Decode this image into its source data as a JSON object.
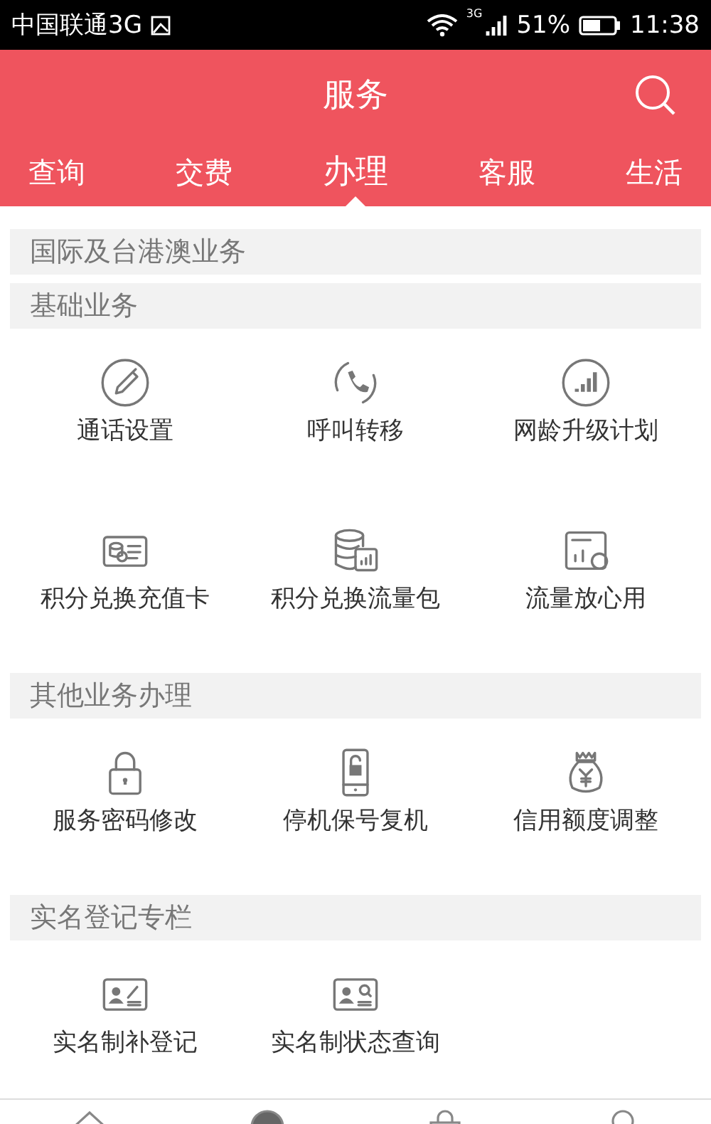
{
  "status_bar": {
    "carrier": "中国联通3G",
    "network": "3G",
    "battery": "51%",
    "time": "11:38"
  },
  "header": {
    "title": "服务"
  },
  "tabs": [
    {
      "label": "查询",
      "selected": false
    },
    {
      "label": "交费",
      "selected": false
    },
    {
      "label": "办理",
      "selected": true
    },
    {
      "label": "客服",
      "selected": false
    },
    {
      "label": "生活",
      "selected": false
    }
  ],
  "sections": [
    {
      "title": "国际及台港澳业务"
    },
    {
      "title": "基础业务",
      "items": [
        {
          "label": "通话设置"
        },
        {
          "label": "呼叫转移"
        },
        {
          "label": "网龄升级计划"
        },
        {
          "label": "积分兑换充值卡"
        },
        {
          "label": "积分兑换流量包"
        },
        {
          "label": "流量放心用"
        }
      ]
    },
    {
      "title": "其他业务办理",
      "items": [
        {
          "label": "服务密码修改"
        },
        {
          "label": "停机保号复机"
        },
        {
          "label": "信用额度调整"
        }
      ]
    },
    {
      "title": "实名登记专栏",
      "items": [
        {
          "label": "实名制补登记"
        },
        {
          "label": "实名制状态查询"
        }
      ]
    }
  ],
  "bottom_nav": [
    {
      "selected": false
    },
    {
      "selected": true
    },
    {
      "selected": false
    },
    {
      "selected": false
    }
  ]
}
